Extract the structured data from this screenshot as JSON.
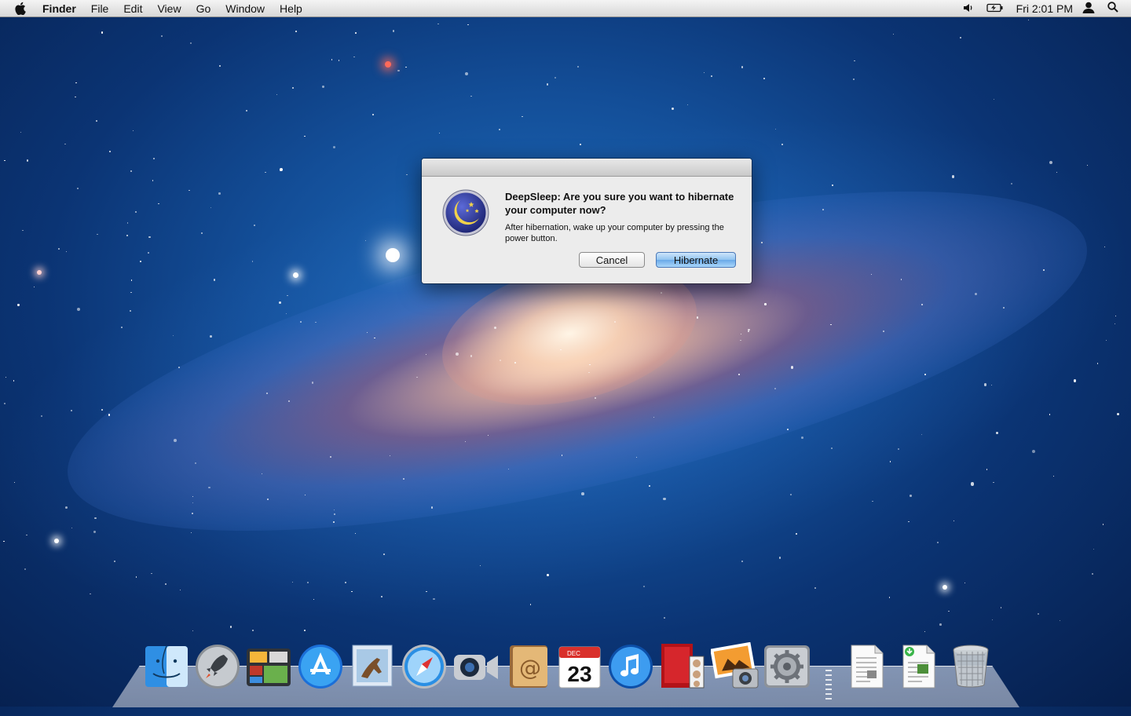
{
  "menubar": {
    "app_name": "Finder",
    "menus": [
      "File",
      "Edit",
      "View",
      "Go",
      "Window",
      "Help"
    ],
    "clock": "Fri 2:01 PM",
    "status_icons": [
      "volume-icon",
      "battery-icon",
      "user-icon",
      "spotlight-icon"
    ]
  },
  "dialog": {
    "headline": "DeepSleep: Are you sure you want to hibernate your computer now?",
    "info": "After hibernation, wake up your computer by pressing the power button.",
    "cancel_label": "Cancel",
    "confirm_label": "Hibernate",
    "icon": "moon-stars-icon"
  },
  "dock": {
    "items": [
      {
        "name": "finder-icon"
      },
      {
        "name": "launchpad-icon"
      },
      {
        "name": "mission-control-icon"
      },
      {
        "name": "app-store-icon"
      },
      {
        "name": "mail-icon"
      },
      {
        "name": "safari-icon"
      },
      {
        "name": "facetime-icon"
      },
      {
        "name": "address-book-icon"
      },
      {
        "name": "ical-icon",
        "month": "DEC",
        "day": "23"
      },
      {
        "name": "itunes-icon"
      },
      {
        "name": "photo-booth-icon"
      },
      {
        "name": "iphoto-icon"
      },
      {
        "name": "system-preferences-icon"
      },
      {
        "name": "document-icon"
      },
      {
        "name": "download-document-icon"
      },
      {
        "name": "trash-icon"
      }
    ]
  },
  "colors": {
    "desktop": "#134e98",
    "primary_button": "#8fc3f0"
  }
}
